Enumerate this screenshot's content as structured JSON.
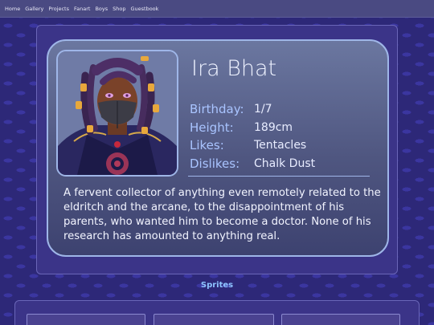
{
  "nav": [
    "Home",
    "Gallery",
    "Projects",
    "Fanart",
    "Boys",
    "Shop",
    "Guestbook"
  ],
  "profile": {
    "name": "Ira Bhat",
    "stats": [
      {
        "label": "Birthday:",
        "value": "1/7"
      },
      {
        "label": "Height:",
        "value": "189cm"
      },
      {
        "label": "Likes:",
        "value": "Tentacles"
      },
      {
        "label": "Dislikes:",
        "value": "Chalk Dust"
      }
    ],
    "description": "A fervent collector of anything even remotely related to the eldritch and the arcane, to the disappointment of his parents, who wanted him to become a doctor. None of his research has amounted to anything real."
  },
  "sprites": {
    "title": "Sprites"
  },
  "colors": {
    "background": "#2d2878",
    "panel": "#3b3488",
    "card_border": "#9fb6e8",
    "stat_label": "#a9c4ff",
    "sprites_title": "#8ec4ff"
  }
}
